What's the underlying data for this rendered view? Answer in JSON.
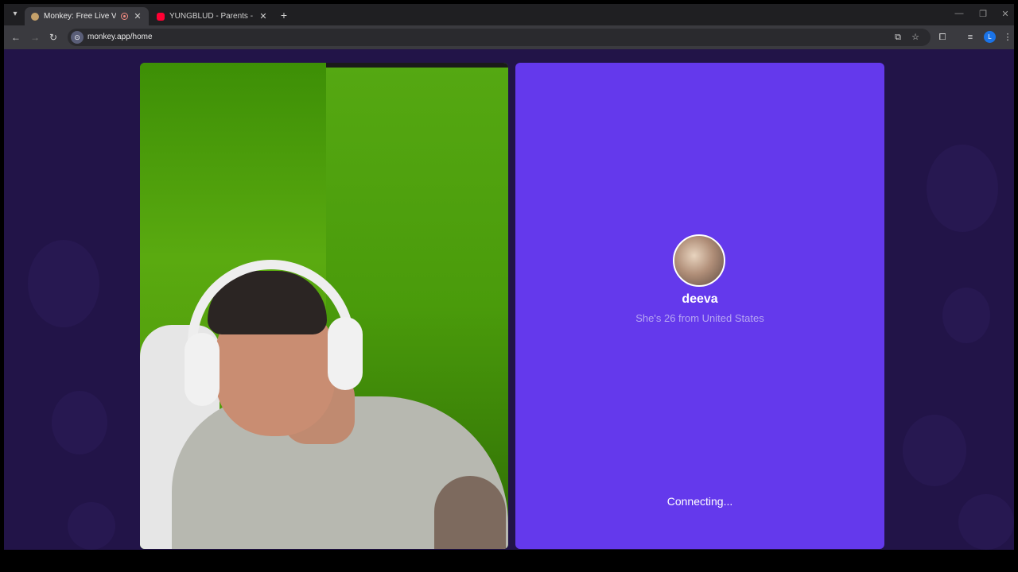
{
  "browser": {
    "tabs": [
      {
        "title": "Monkey: Free Live Video Ch",
        "icon": "monkey-icon",
        "recording": true,
        "active": true
      },
      {
        "title": "YUNGBLUD - Parents - YouTub",
        "icon": "youtube-icon",
        "recording": false,
        "active": false
      }
    ],
    "url": "monkey.app/home",
    "profile_initial": "L"
  },
  "call": {
    "peer_name": "deeva",
    "peer_info": "She's 26 from United States",
    "status": "Connecting..."
  },
  "colors": {
    "page_background": "#221448",
    "peer_panel": "#6439ec",
    "peer_info_text": "#b7a6f2"
  }
}
